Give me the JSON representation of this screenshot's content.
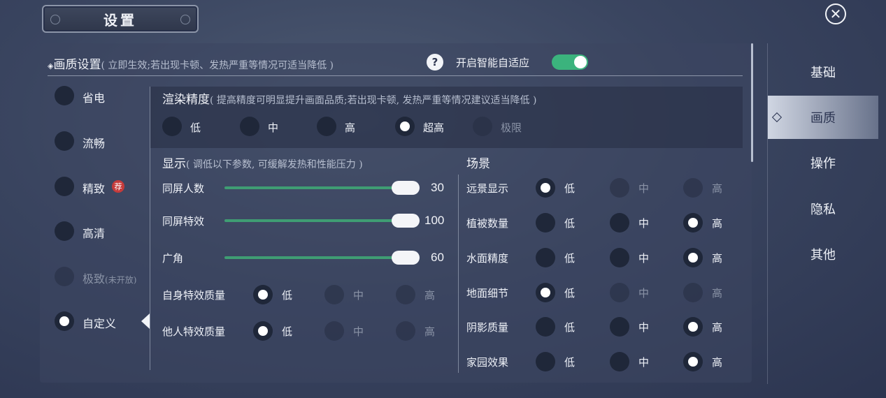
{
  "header": {
    "title": "设置",
    "close_icon": "close-icon"
  },
  "quality_section": {
    "title": "画质设置",
    "subtitle": "( 立即生效;若出现卡顿、发热严重等情况可适当降低 )",
    "help_label": "?",
    "auto_adapt_label": "开启智能自适应",
    "auto_adapt_on": true
  },
  "presets": [
    {
      "label": "省电",
      "state": "off"
    },
    {
      "label": "流畅",
      "state": "off"
    },
    {
      "label": "精致",
      "state": "off",
      "badge": "荐"
    },
    {
      "label": "高清",
      "state": "off"
    },
    {
      "label": "极致",
      "sublabel": "(未开放)",
      "state": "disabled"
    },
    {
      "label": "自定义",
      "state": "selected"
    }
  ],
  "render_precision": {
    "title": "渲染精度",
    "subtitle": "( 提高精度可明显提升画面品质;若出现卡顿, 发热严重等情况建议适当降低 )",
    "options": [
      "低",
      "中",
      "高",
      "超高",
      "极限"
    ],
    "selected": "超高",
    "disabled": [
      "极限"
    ]
  },
  "display": {
    "title": "显示",
    "subtitle": "( 调低以下参数, 可缓解发热和性能压力 )",
    "sliders": [
      {
        "label": "同屏人数",
        "value": "30"
      },
      {
        "label": "同屏特效",
        "value": "100"
      },
      {
        "label": "广角",
        "value": "60"
      }
    ],
    "effect_rows": [
      {
        "label": "自身特效质量",
        "options": [
          "低",
          "中",
          "高"
        ],
        "selected": "低",
        "disabled": [
          "中",
          "高"
        ]
      },
      {
        "label": "他人特效质量",
        "options": [
          "低",
          "中",
          "高"
        ],
        "selected": "低",
        "disabled": [
          "中",
          "高"
        ]
      }
    ]
  },
  "scene": {
    "title": "场景",
    "rows": [
      {
        "label": "远景显示",
        "options": [
          "低",
          "中",
          "高"
        ],
        "selected": "低",
        "disabled": [
          "中",
          "高"
        ]
      },
      {
        "label": "植被数量",
        "options": [
          "低",
          "中",
          "高"
        ],
        "selected": "高",
        "disabled": []
      },
      {
        "label": "水面精度",
        "options": [
          "低",
          "中",
          "高"
        ],
        "selected": "高",
        "disabled": []
      },
      {
        "label": "地面细节",
        "options": [
          "低",
          "中",
          "高"
        ],
        "selected": "低",
        "disabled": [
          "中",
          "高"
        ]
      },
      {
        "label": "阴影质量",
        "options": [
          "低",
          "中",
          "高"
        ],
        "selected": "高",
        "disabled": []
      },
      {
        "label": "家园效果",
        "options": [
          "低",
          "中",
          "高"
        ],
        "selected": "高",
        "disabled": []
      }
    ]
  },
  "nav": {
    "items": [
      "基础",
      "画质",
      "操作",
      "隐私",
      "其他"
    ],
    "active": "画质"
  },
  "colors": {
    "accent_green": "#3bb37d",
    "badge_red": "#c53b3b"
  }
}
